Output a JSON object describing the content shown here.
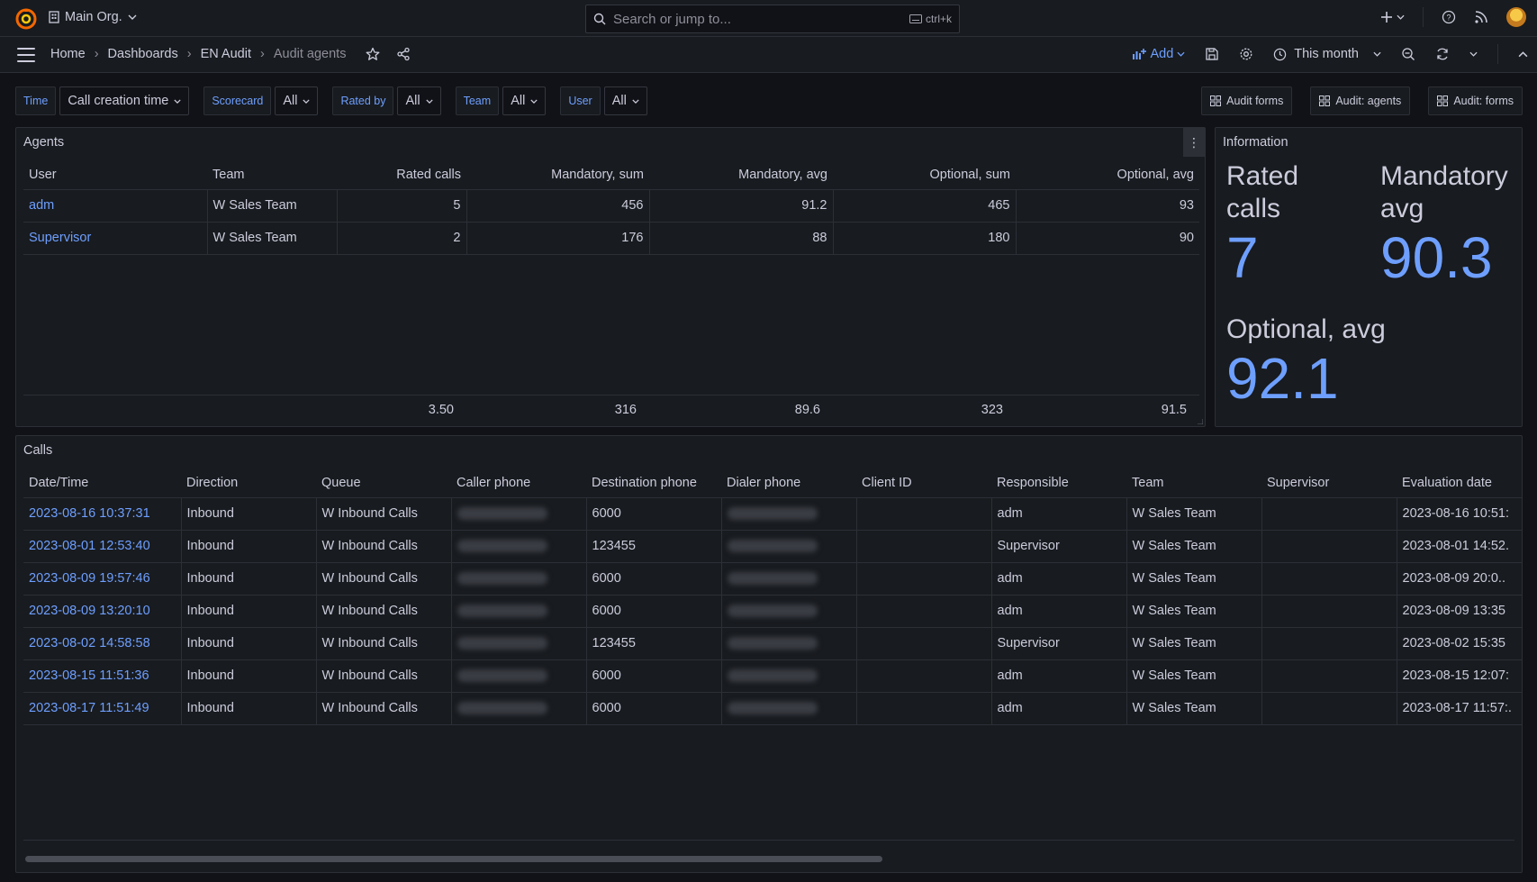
{
  "topbar": {
    "org": "Main Org.",
    "search_placeholder": "Search or jump to...",
    "search_shortcut": "ctrl+k"
  },
  "navbar": {
    "crumbs": [
      "Home",
      "Dashboards",
      "EN Audit",
      "Audit agents"
    ],
    "add_label": "Add",
    "time_range": "This month"
  },
  "variables": [
    {
      "label": "Time",
      "value": "Call creation time"
    },
    {
      "label": "Scorecard",
      "value": "All"
    },
    {
      "label": "Rated by",
      "value": "All"
    },
    {
      "label": "Team",
      "value": "All"
    },
    {
      "label": "User",
      "value": "All"
    }
  ],
  "links": [
    "Audit forms",
    "Audit: agents",
    "Audit: forms"
  ],
  "agents": {
    "title": "Agents",
    "columns": [
      "User",
      "Team",
      "Rated calls",
      "Mandatory, sum",
      "Mandatory, avg",
      "Optional, sum",
      "Optional, avg"
    ],
    "rows": [
      [
        "adm",
        "W Sales Team",
        "5",
        "456",
        "91.2",
        "465",
        "93"
      ],
      [
        "Supervisor",
        "W Sales Team",
        "2",
        "176",
        "88",
        "180",
        "90"
      ]
    ],
    "footer": [
      "3.50",
      "316",
      "89.6",
      "323",
      "91.5"
    ]
  },
  "information": {
    "title": "Information",
    "stats": [
      {
        "label_l1": "Rated",
        "label_l2": "calls",
        "value": "7"
      },
      {
        "label_l1": "Mandatory",
        "label_l2": "avg",
        "value": "90.3"
      },
      {
        "label_l1": "Optional, avg",
        "label_l2": "",
        "value": "92.1"
      }
    ]
  },
  "calls": {
    "title": "Calls",
    "columns": [
      "Date/Time",
      "Direction",
      "Queue",
      "Caller phone",
      "Destination phone",
      "Dialer phone",
      "Client ID",
      "Responsible",
      "Team",
      "Supervisor",
      "Evaluation date"
    ],
    "rows": [
      [
        "2023-08-16 10:37:31",
        "Inbound",
        "W Inbound Calls",
        "",
        "6000",
        "",
        "",
        "adm",
        "W Sales Team",
        "",
        "2023-08-16 10:51:"
      ],
      [
        "2023-08-01 12:53:40",
        "Inbound",
        "W Inbound Calls",
        "",
        "123455",
        "",
        "",
        "Supervisor",
        "W Sales Team",
        "",
        "2023-08-01 14:52."
      ],
      [
        "2023-08-09 19:57:46",
        "Inbound",
        "W Inbound Calls",
        "",
        "6000",
        "",
        "",
        "adm",
        "W Sales Team",
        "",
        "2023-08-09 20:0.."
      ],
      [
        "2023-08-09 13:20:10",
        "Inbound",
        "W Inbound Calls",
        "",
        "6000",
        "",
        "",
        "adm",
        "W Sales Team",
        "",
        "2023-08-09 13:35"
      ],
      [
        "2023-08-02 14:58:58",
        "Inbound",
        "W Inbound Calls",
        "",
        "123455",
        "",
        "",
        "Supervisor",
        "W Sales Team",
        "",
        "2023-08-02 15:35"
      ],
      [
        "2023-08-15 11:51:36",
        "Inbound",
        "W Inbound Calls",
        "",
        "6000",
        "",
        "",
        "adm",
        "W Sales Team",
        "",
        "2023-08-15 12:07:"
      ],
      [
        "2023-08-17 11:51:49",
        "Inbound",
        "W Inbound Calls",
        "",
        "6000",
        "",
        "",
        "adm",
        "W Sales Team",
        "",
        "2023-08-17 11:57:."
      ]
    ]
  },
  "colors": {
    "accent": "#6e9fff",
    "background": "#111217",
    "panel": "#181b1f",
    "border": "#2c2f36"
  }
}
